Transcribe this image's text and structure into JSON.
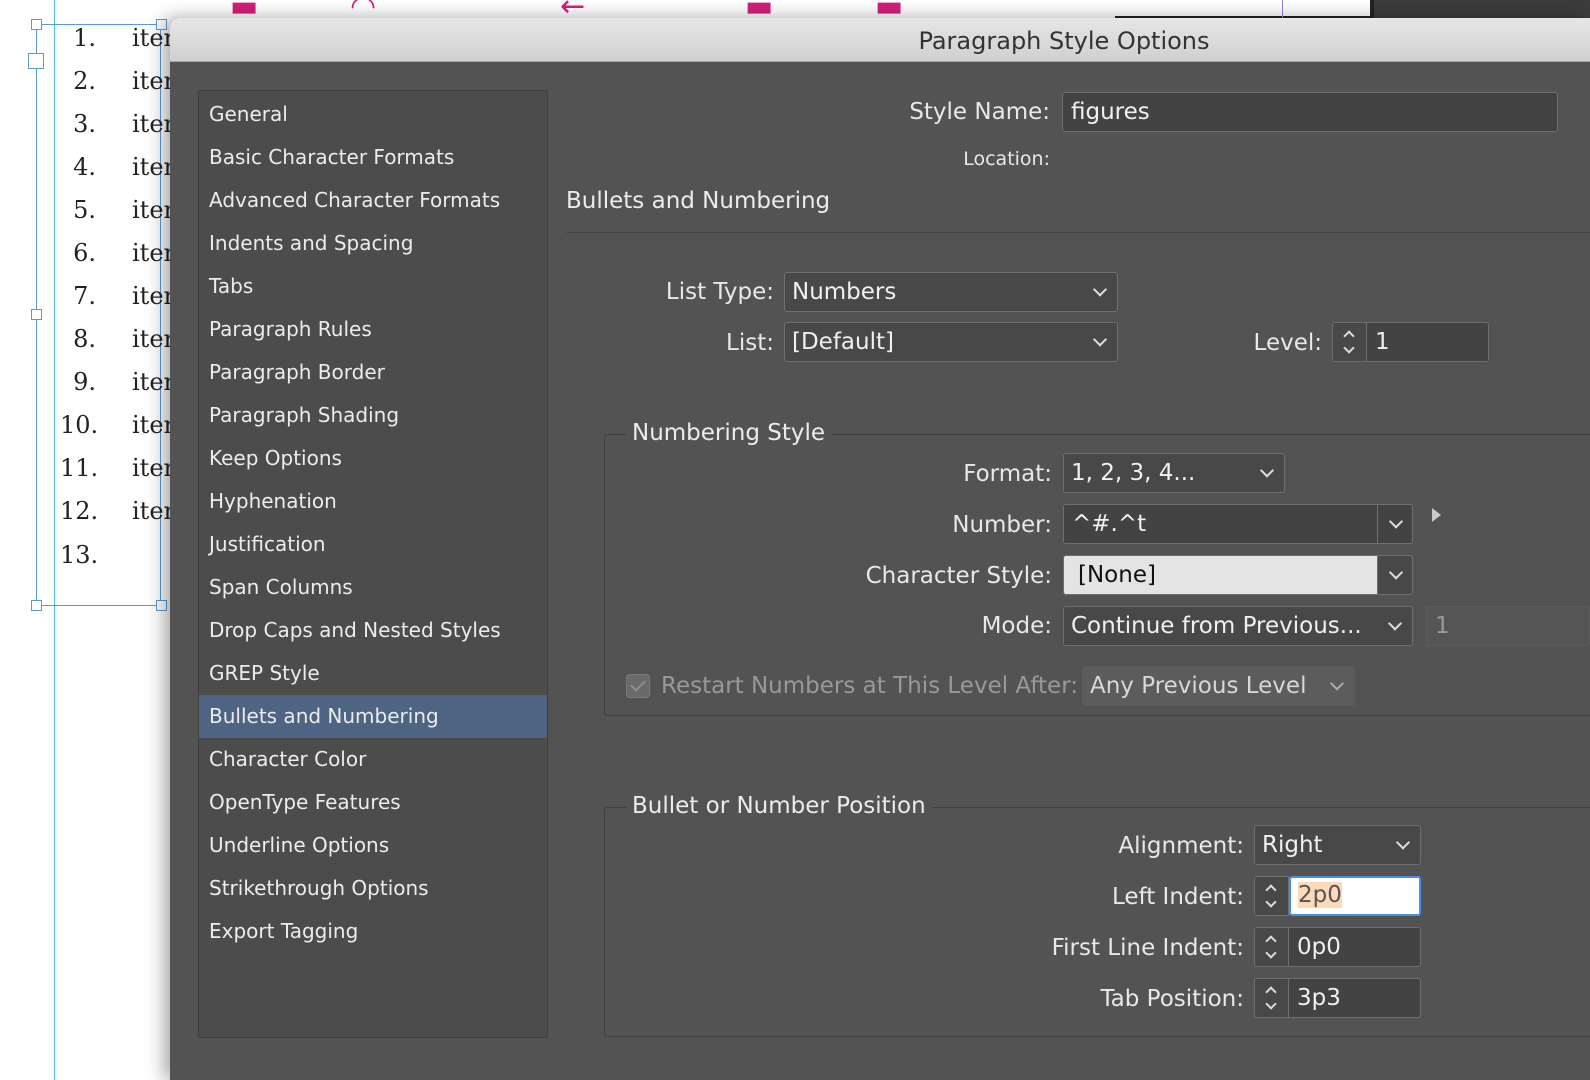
{
  "document": {
    "list_numbers": [
      "1.",
      "2.",
      "3.",
      "4.",
      "5.",
      "6.",
      "7.",
      "8.",
      "9.",
      "10.",
      "11.",
      "12.",
      "13."
    ],
    "list_item_text": "iter"
  },
  "dialog": {
    "title": "Paragraph Style Options",
    "sidebar": {
      "items": [
        {
          "label": "General"
        },
        {
          "label": "Basic Character Formats"
        },
        {
          "label": "Advanced Character Formats"
        },
        {
          "label": "Indents and Spacing"
        },
        {
          "label": "Tabs"
        },
        {
          "label": "Paragraph Rules"
        },
        {
          "label": "Paragraph Border"
        },
        {
          "label": "Paragraph Shading"
        },
        {
          "label": "Keep Options"
        },
        {
          "label": "Hyphenation"
        },
        {
          "label": "Justification"
        },
        {
          "label": "Span Columns"
        },
        {
          "label": "Drop Caps and Nested Styles"
        },
        {
          "label": "GREP Style"
        },
        {
          "label": "Bullets and Numbering",
          "selected": true
        },
        {
          "label": "Character Color"
        },
        {
          "label": "OpenType Features"
        },
        {
          "label": "Underline Options"
        },
        {
          "label": "Strikethrough Options"
        },
        {
          "label": "Export Tagging"
        }
      ]
    },
    "style_name": {
      "label": "Style Name:",
      "value": "figures"
    },
    "location": {
      "label": "Location:"
    },
    "section_title": "Bullets and Numbering",
    "list_type": {
      "label": "List Type:",
      "value": "Numbers"
    },
    "list": {
      "label": "List:",
      "value": "[Default]"
    },
    "level": {
      "label": "Level:",
      "value": "1"
    },
    "numbering_style": {
      "title": "Numbering Style",
      "format": {
        "label": "Format:",
        "value": "1, 2, 3, 4..."
      },
      "number": {
        "label": "Number:",
        "value": "^#.^t"
      },
      "character_style": {
        "label": "Character Style:",
        "value": "[None]"
      },
      "mode": {
        "label": "Mode:",
        "value": "Continue from Previous...",
        "start_value": "1"
      },
      "restart": {
        "label": "Restart Numbers at This Level After:",
        "value": "Any Previous Level",
        "checked": true
      }
    },
    "position": {
      "title": "Bullet or Number Position",
      "alignment": {
        "label": "Alignment:",
        "value": "Right"
      },
      "left_indent": {
        "label": "Left Indent:",
        "value": "2p0"
      },
      "first_line_indent": {
        "label": "First Line Indent:",
        "value": "0p0"
      },
      "tab_position": {
        "label": "Tab Position:",
        "value": "3p3"
      }
    }
  },
  "colors": {
    "dialog_bg": "#535353",
    "selection": "#4d6582",
    "guide": "#46c7d8",
    "frame": "#5b9bd5",
    "focus": "#4a8fe7",
    "highlight_text": "#fcd9b8"
  }
}
